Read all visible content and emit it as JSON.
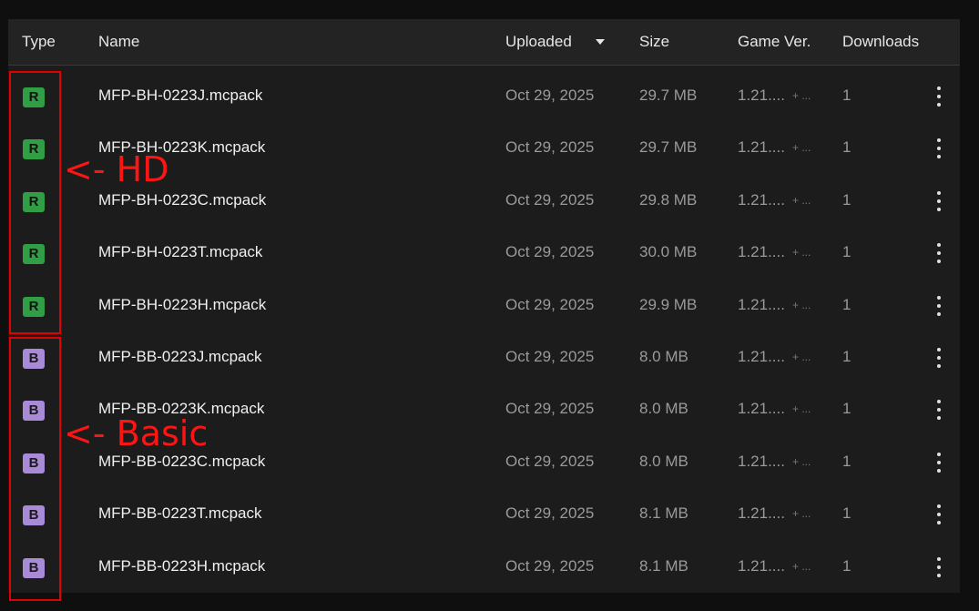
{
  "columns": {
    "type": "Type",
    "name": "Name",
    "uploaded": "Uploaded",
    "size": "Size",
    "game_ver": "Game Ver.",
    "downloads": "Downloads"
  },
  "colors": {
    "release_badge": "#2f9e44",
    "beta_badge": "#a98ad6",
    "annotation": "#e30000"
  },
  "files": [
    {
      "type": "R",
      "name": "MFP-BH-0223J.mcpack",
      "uploaded": "Oct 29, 2025",
      "size": "29.7 MB",
      "version": "1.21....",
      "more": "+ ...",
      "downloads": "1"
    },
    {
      "type": "R",
      "name": "MFP-BH-0223K.mcpack",
      "uploaded": "Oct 29, 2025",
      "size": "29.7 MB",
      "version": "1.21....",
      "more": "+ ...",
      "downloads": "1"
    },
    {
      "type": "R",
      "name": "MFP-BH-0223C.mcpack",
      "uploaded": "Oct 29, 2025",
      "size": "29.8 MB",
      "version": "1.21....",
      "more": "+ ...",
      "downloads": "1"
    },
    {
      "type": "R",
      "name": "MFP-BH-0223T.mcpack",
      "uploaded": "Oct 29, 2025",
      "size": "30.0 MB",
      "version": "1.21....",
      "more": "+ ...",
      "downloads": "1"
    },
    {
      "type": "R",
      "name": "MFP-BH-0223H.mcpack",
      "uploaded": "Oct 29, 2025",
      "size": "29.9 MB",
      "version": "1.21....",
      "more": "+ ...",
      "downloads": "1"
    },
    {
      "type": "B",
      "name": "MFP-BB-0223J.mcpack",
      "uploaded": "Oct 29, 2025",
      "size": "8.0 MB",
      "version": "1.21....",
      "more": "+ ...",
      "downloads": "1"
    },
    {
      "type": "B",
      "name": "MFP-BB-0223K.mcpack",
      "uploaded": "Oct 29, 2025",
      "size": "8.0 MB",
      "version": "1.21....",
      "more": "+ ...",
      "downloads": "1"
    },
    {
      "type": "B",
      "name": "MFP-BB-0223C.mcpack",
      "uploaded": "Oct 29, 2025",
      "size": "8.0 MB",
      "version": "1.21....",
      "more": "+ ...",
      "downloads": "1"
    },
    {
      "type": "B",
      "name": "MFP-BB-0223T.mcpack",
      "uploaded": "Oct 29, 2025",
      "size": "8.1 MB",
      "version": "1.21....",
      "more": "+ ...",
      "downloads": "1"
    },
    {
      "type": "B",
      "name": "MFP-BB-0223H.mcpack",
      "uploaded": "Oct 29, 2025",
      "size": "8.1 MB",
      "version": "1.21....",
      "more": "+ ...",
      "downloads": "1"
    }
  ],
  "annotations": {
    "hd": "<- HD",
    "basic": "<- Basic"
  }
}
